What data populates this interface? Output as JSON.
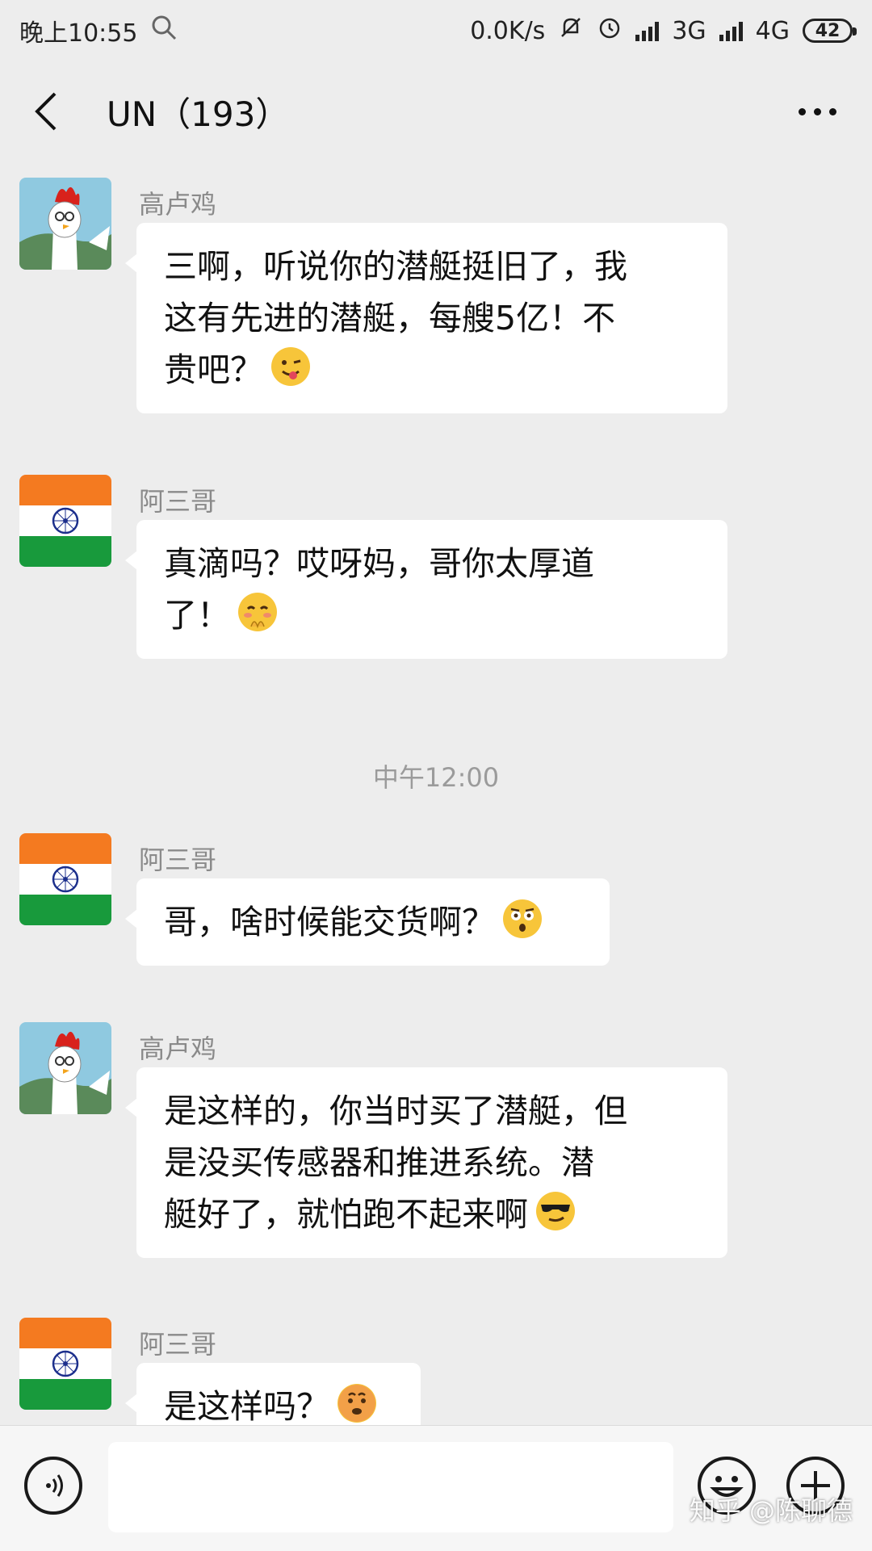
{
  "status_bar": {
    "time": "晚上10:55",
    "net_speed": "0.0K/s",
    "network_1": "3G",
    "network_2": "4G",
    "battery": "42",
    "icons": [
      "search-icon",
      "mute-icon",
      "alarm-icon",
      "signal-icon",
      "battery-icon"
    ]
  },
  "header": {
    "title": "UN（193）"
  },
  "chat": {
    "messages": [
      {
        "sender": "高卢鸡",
        "avatar": "rooster-avatar",
        "lines": [
          "三啊，听说你的潜艇挺旧了，我",
          "这有先进的潜艇，每艘5亿！不",
          "贵吧？"
        ],
        "emoji": "wink-tongue"
      },
      {
        "sender": "阿三哥",
        "avatar": "india-flag-avatar",
        "lines": [
          "真滴吗？哎呀妈，哥你太厚道",
          "了！"
        ],
        "emoji": "blush-hands"
      },
      {
        "sender": "阿三哥",
        "avatar": "india-flag-avatar",
        "lines": [
          "哥，啥时候能交货啊？"
        ],
        "emoji": "shocked"
      },
      {
        "sender": "高卢鸡",
        "avatar": "rooster-avatar",
        "lines": [
          "是这样的，你当时买了潜艇，但",
          "是没买传感器和推进系统。潜",
          "艇好了，就怕跑不起来啊"
        ],
        "emoji": "sunglasses-smirk"
      },
      {
        "sender": "阿三哥",
        "avatar": "india-flag-avatar",
        "lines": [
          "是这样吗？"
        ],
        "emoji": "worried"
      }
    ],
    "timestamp": "中午12:00"
  },
  "input_bar": {
    "icons": [
      "voice-icon",
      "emoji-icon",
      "plus-icon"
    ]
  },
  "watermark": "知乎 @陈聊德",
  "colors": {
    "background": "#ededed",
    "bubble": "#ffffff",
    "sender": "#8a8a8a",
    "india_saffron": "#f47a20",
    "india_green": "#189a3c",
    "chakra": "#1c2f8c"
  }
}
